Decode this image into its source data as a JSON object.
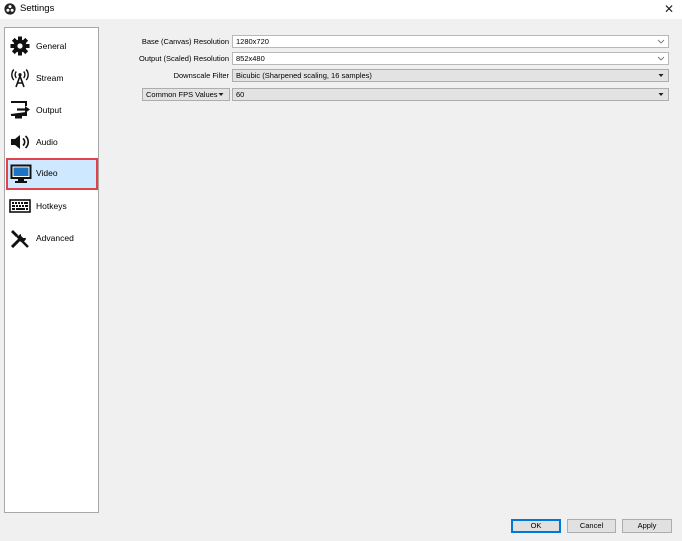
{
  "window": {
    "title": "Settings",
    "close_glyph": "✕",
    "app_icon": "obs-logo-icon"
  },
  "sidebar": {
    "items": [
      {
        "label": "General",
        "icon": "gear-icon"
      },
      {
        "label": "Stream",
        "icon": "broadcast-antenna-icon"
      },
      {
        "label": "Output",
        "icon": "output-monitor-arrow-icon"
      },
      {
        "label": "Audio",
        "icon": "speaker-icon"
      },
      {
        "label": "Video",
        "icon": "monitor-icon",
        "selected": true
      },
      {
        "label": "Hotkeys",
        "icon": "keyboard-icon"
      },
      {
        "label": "Advanced",
        "icon": "tools-icon"
      }
    ]
  },
  "video": {
    "base_resolution": {
      "label": "Base (Canvas) Resolution",
      "value": "1280x720"
    },
    "output_resolution": {
      "label": "Output (Scaled) Resolution",
      "value": "852x480"
    },
    "downscale_filter": {
      "label": "Downscale Filter",
      "value": "Bicubic (Sharpened scaling, 16 samples)"
    },
    "fps": {
      "label": "Common FPS Values",
      "value": "60"
    }
  },
  "buttons": {
    "ok": "OK",
    "cancel": "Cancel",
    "apply": "Apply"
  },
  "colors": {
    "selected_bg": "#cde8ff",
    "selected_border": "#e0424a",
    "default_button_border": "#0078d7"
  }
}
